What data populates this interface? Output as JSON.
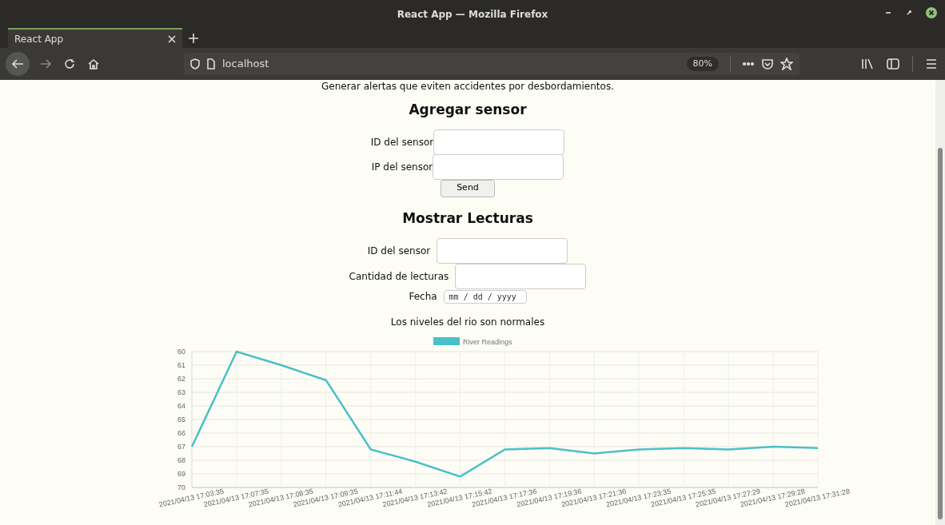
{
  "window": {
    "title": "React App — Mozilla Firefox"
  },
  "tabs": [
    {
      "label": "React App",
      "selected": true
    }
  ],
  "address_bar": {
    "url": "localhost",
    "zoom": "80%"
  },
  "page": {
    "intro": "Generar alertas que eviten accidentes por desbordamientos.",
    "add_sensor": {
      "heading": "Agregar sensor",
      "fields": [
        {
          "label": "ID del sensor"
        },
        {
          "label": "IP del sensor"
        }
      ],
      "button": "Send"
    },
    "show_readings": {
      "heading": "Mostrar Lecturas",
      "fields": [
        {
          "label": "ID del sensor",
          "kind": "text"
        },
        {
          "label": "Cantidad de lecturas",
          "kind": "text"
        },
        {
          "label": "Fecha",
          "kind": "date",
          "placeholder": "mm / dd / yyyy"
        }
      ]
    },
    "status": "Los niveles del rio son normales",
    "chart_data": {
      "type": "line",
      "categories": [
        "2021/04/13 17:03:35",
        "2021/04/13 17:07:35",
        "2021/04/13 17:08:35",
        "2021/04/13 17:09:35",
        "2021/04/13 17:11:44",
        "2021/04/13 17:13:42",
        "2021/04/13 17:15:42",
        "2021/04/13 17:17:36",
        "2021/04/13 17:19:36",
        "2021/04/13 17:21:36",
        "2021/04/13 17:23:35",
        "2021/04/13 17:25:35",
        "2021/04/13 17:27:29",
        "2021/04/13 17:29:28",
        "2021/04/13 17:31:28"
      ],
      "series": [
        {
          "name": "River Readings",
          "color": "#4bc0c8",
          "values": [
            67.0,
            60.0,
            61.0,
            62.1,
            67.2,
            68.1,
            69.2,
            67.2,
            67.1,
            67.5,
            67.2,
            67.1,
            67.2,
            67.0,
            67.1
          ]
        }
      ],
      "grid": true,
      "ylim": [
        70,
        60
      ],
      "yticks": [
        60,
        61,
        62,
        63,
        64,
        65,
        66,
        67,
        68,
        69,
        70
      ]
    }
  }
}
